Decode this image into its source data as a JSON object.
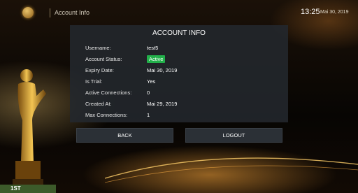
{
  "header": {
    "title": "Account Info",
    "time": "13:25",
    "date": "Mai 30, 2019",
    "logo_icon": "trophy-logo-icon"
  },
  "panel": {
    "title": "ACCOUNT INFO",
    "rows": [
      {
        "label": "Username:",
        "value": "test5"
      },
      {
        "label": "Account Status:",
        "value": "Active"
      },
      {
        "label": "Expiry Date:",
        "value": "Mai 30, 2019"
      },
      {
        "label": "Is Trial:",
        "value": "Yes"
      },
      {
        "label": "Active Connections:",
        "value": "0"
      },
      {
        "label": "Created At:",
        "value": "Mai 29, 2019"
      },
      {
        "label": "Max Connections:",
        "value": "1"
      }
    ]
  },
  "buttons": {
    "back": "BACK",
    "logout": "LOGOUT"
  },
  "decor": {
    "corner_badge": "1ST"
  },
  "colors": {
    "accent": "#22b04a",
    "panel_bg": "#23282e",
    "gold": "#d9a441"
  }
}
